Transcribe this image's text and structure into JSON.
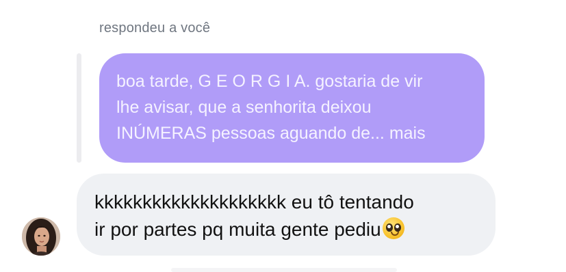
{
  "reply_context": "respondeu a você",
  "quoted_message": {
    "lines": [
      "boa tarde, G E O R G I A. gostaria de vir",
      "lhe avisar, que a senhorita deixou",
      "INÚMERAS pessoas aguando de... mais"
    ],
    "color": "#b09cf8"
  },
  "message": {
    "lines": [
      "kkkkkkkkkkkkkkkkkkkk eu tô tentando",
      "ir por partes pq muita gente pediu"
    ],
    "emoji": "pleading-face-emoji",
    "color": "#eff1f4"
  },
  "sender": {
    "avatar_icon": "profile-photo"
  }
}
